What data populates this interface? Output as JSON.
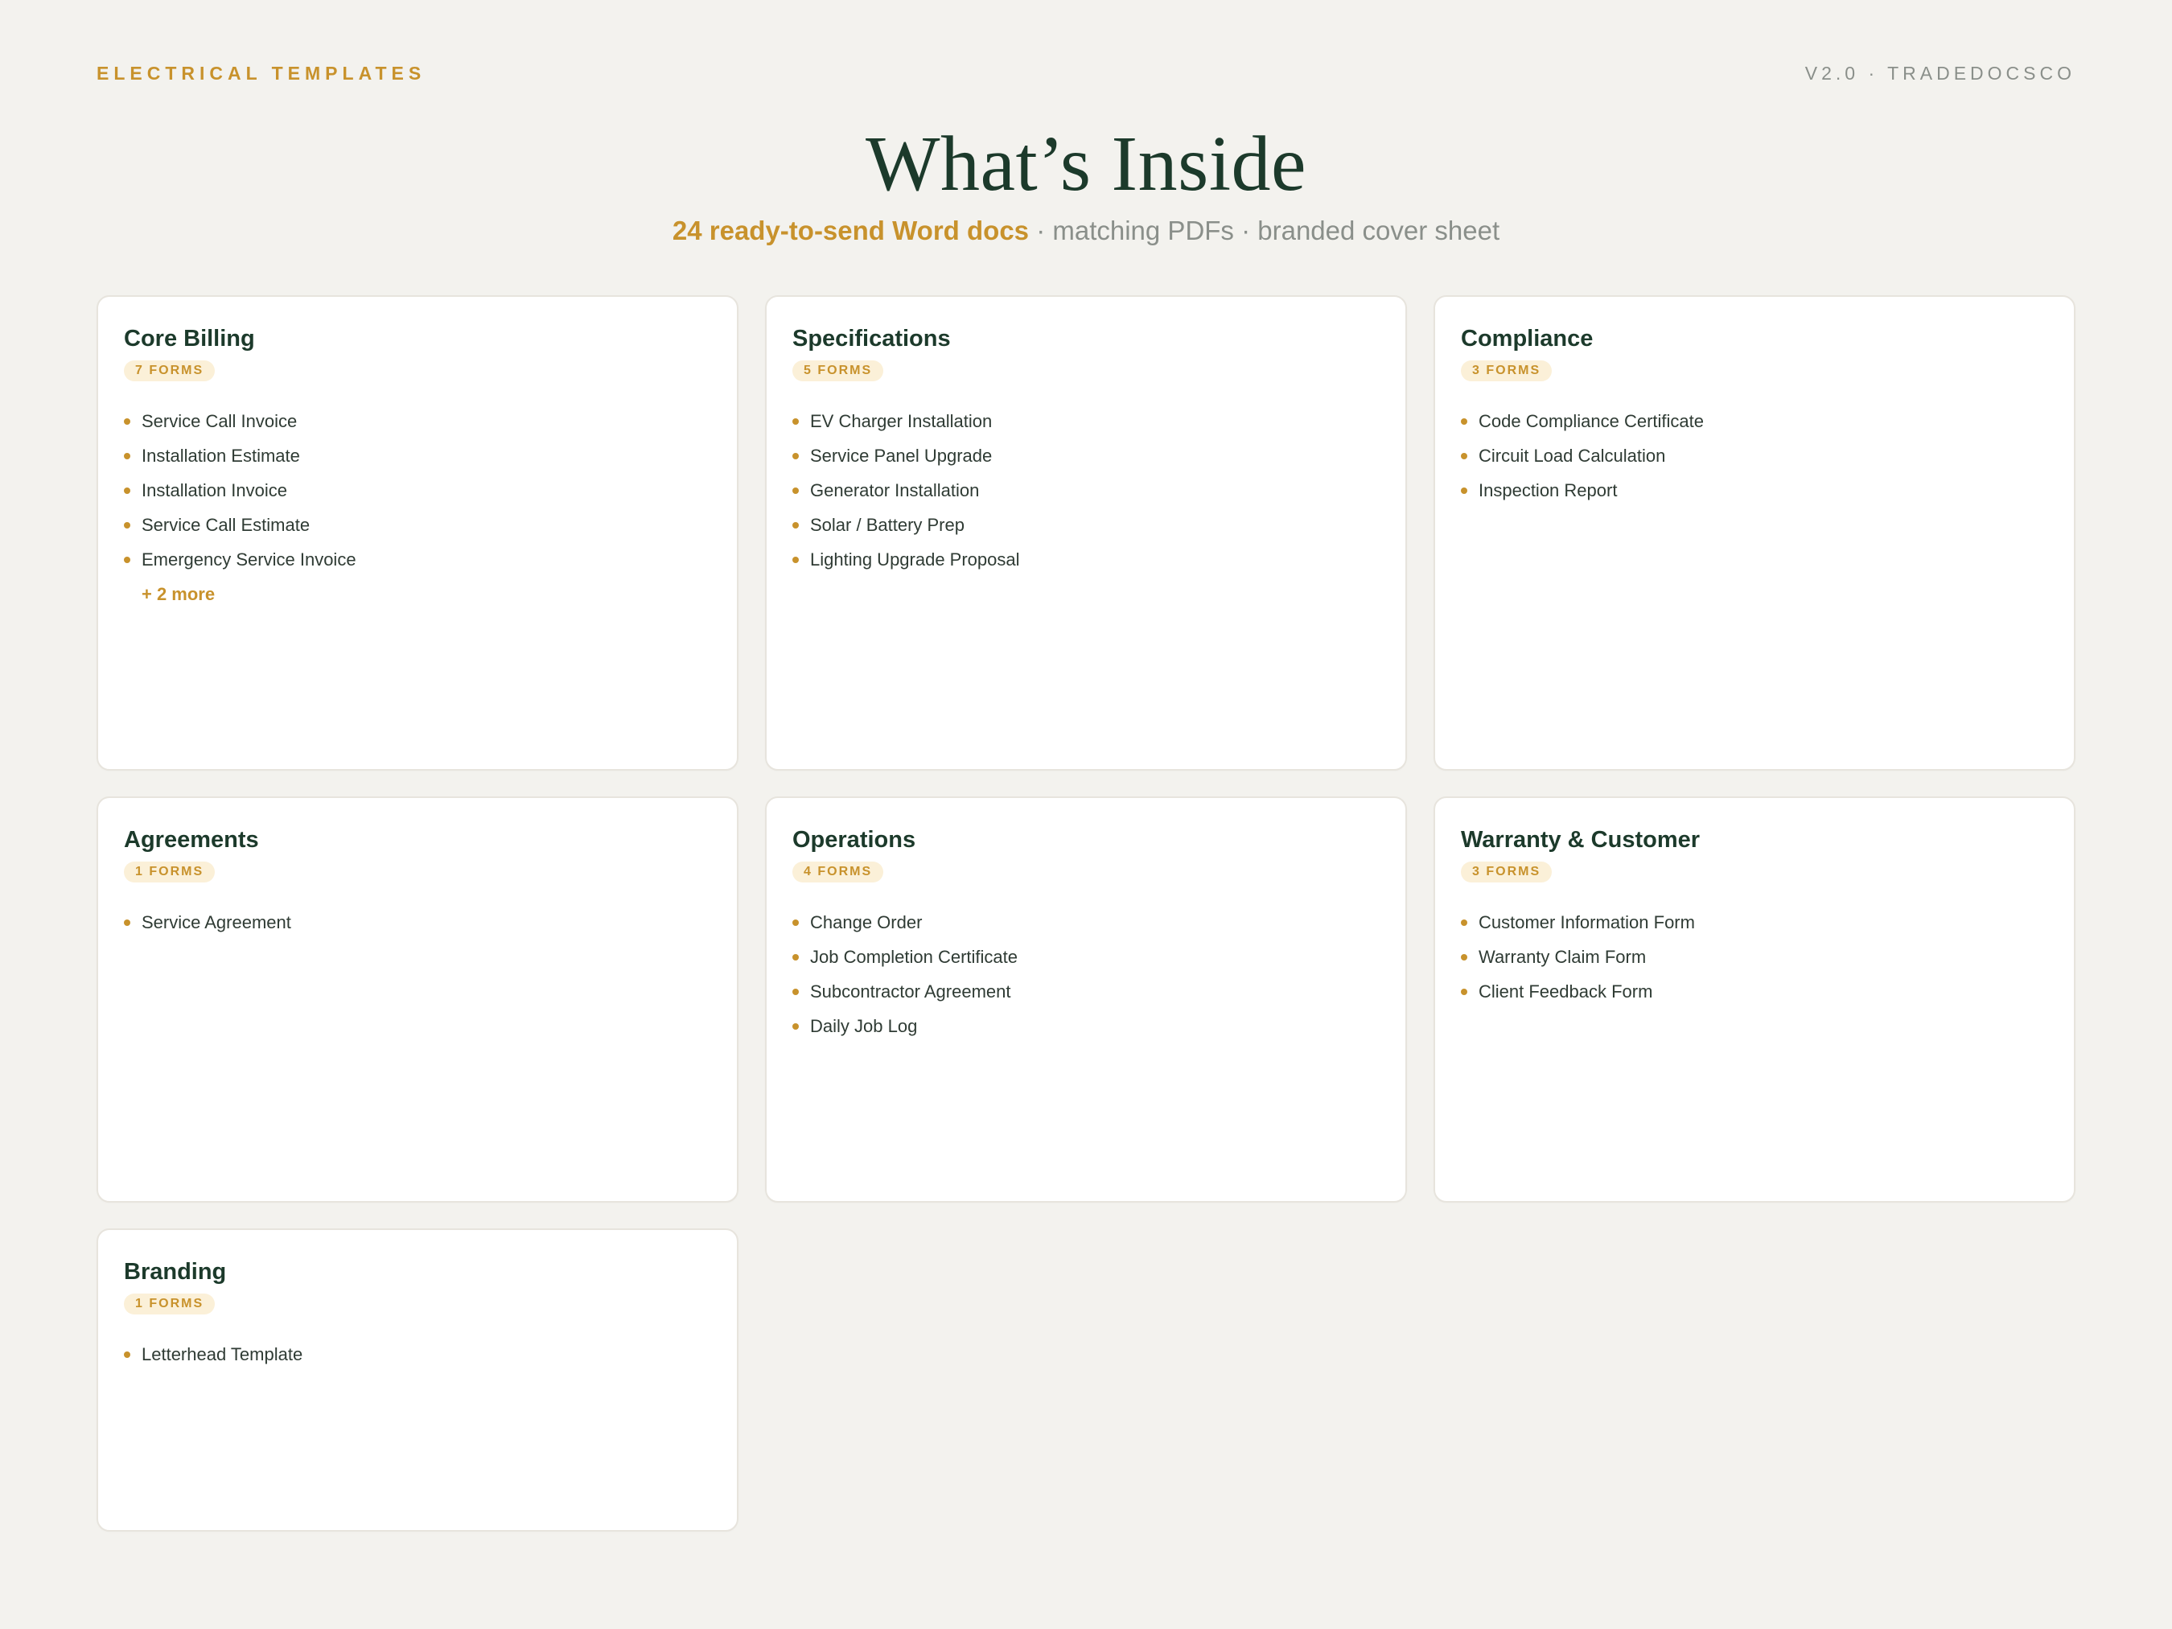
{
  "header": {
    "brand": "ELECTRICAL TEMPLATES",
    "version": "V2.0 · TRADEDOCSCO",
    "title": "What’s Inside",
    "subtitle_highlight": "24 ready-to-send Word docs",
    "subtitle_rest": " · matching PDFs · branded cover sheet"
  },
  "colors": {
    "accent": "#c8922c",
    "title": "#1c3a2b",
    "background": "#f3f2ee",
    "muted": "#8a8f8a"
  },
  "cards": [
    {
      "title": "Core Billing",
      "badge": "7 FORMS",
      "items": [
        "Service Call Invoice",
        "Installation Estimate",
        "Installation Invoice",
        "Service Call Estimate",
        "Emergency Service Invoice"
      ],
      "more": "+ 2 more"
    },
    {
      "title": "Specifications",
      "badge": "5 FORMS",
      "items": [
        "EV Charger Installation",
        "Service Panel Upgrade",
        "Generator Installation",
        "Solar / Battery Prep",
        "Lighting Upgrade Proposal"
      ]
    },
    {
      "title": "Compliance",
      "badge": "3 FORMS",
      "items": [
        "Code Compliance Certificate",
        "Circuit Load Calculation",
        "Inspection Report"
      ]
    },
    {
      "title": "Agreements",
      "badge": "1 FORMS",
      "items": [
        "Service Agreement"
      ]
    },
    {
      "title": "Operations",
      "badge": "4 FORMS",
      "items": [
        "Change Order",
        "Job Completion Certificate",
        "Subcontractor Agreement",
        "Daily Job Log"
      ]
    },
    {
      "title": "Warranty & Customer",
      "badge": "3 FORMS",
      "items": [
        "Customer Information Form",
        "Warranty Claim Form",
        "Client Feedback Form"
      ]
    },
    {
      "title": "Branding",
      "badge": "1 FORMS",
      "items": [
        "Letterhead Template"
      ]
    }
  ]
}
